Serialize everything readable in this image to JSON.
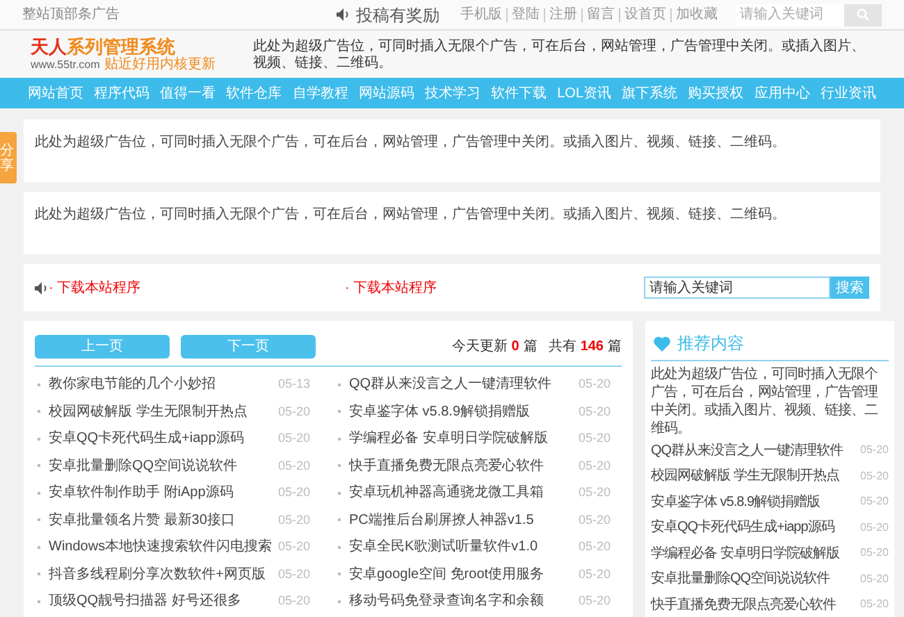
{
  "top_bar": {
    "left_text": "整站顶部条广告",
    "promo": "投稿有奖励",
    "links": [
      "手机版",
      "登陆",
      "注册",
      "留言",
      "设首页",
      "加收藏"
    ],
    "search": {
      "placeholder": "请输入关键词"
    }
  },
  "header": {
    "logo": {
      "part_1": "天人",
      "part_2": "系列管理系统",
      "url": "www.55tr.com",
      "slogan": "贴近好用内核更新"
    },
    "ad": "此处为超级广告位，可同时插入无限个广告，可在后台，网站管理，广告管理中关闭。或插入图片、视频、链接、二维码。"
  },
  "nav": [
    "网站首页",
    "程序代码",
    "值得一看",
    "软件仓库",
    "自学教程",
    "网站源码",
    "技术学习",
    "软件下载",
    "LOL资讯",
    "旗下系统",
    "购买授权",
    "应用中心",
    "行业资讯"
  ],
  "share_tab": "分享",
  "ads": [
    "此处为超级广告位，可同时插入无限个广告，可在后台，网站管理，广告管理中关闭。或插入图片、视频、链接、二维码。",
    "此处为超级广告位，可同时插入无限个广告，可在后台，网站管理，广告管理中关闭。或插入图片、视频、链接、二维码。"
  ],
  "notice_bar": {
    "links": [
      "· 下载本站程序",
      "· 下载本站程序"
    ],
    "search": {
      "value": "请输入关键词",
      "button": "搜索"
    }
  },
  "list_panel": {
    "prev": "上一页",
    "next": "下一页",
    "today_label": "今天更新",
    "today_count": "0",
    "unit_1": "篇",
    "total_label": "共有",
    "total_count": "146",
    "unit_2": "篇",
    "items": [
      {
        "title": "教你家电节能的几个小妙招",
        "date": "05-13"
      },
      {
        "title": "QQ群从来没言之人一键清理软件",
        "date": "05-20"
      },
      {
        "title": "校园网破解版 学生无限制开热点",
        "date": "05-20"
      },
      {
        "title": "安卓鉴字体 v5.8.9解锁捐赠版",
        "date": "05-20"
      },
      {
        "title": "安卓QQ卡死代码生成+iapp源码",
        "date": "05-20"
      },
      {
        "title": "学编程必备 安卓明日学院破解版",
        "date": "05-20"
      },
      {
        "title": "安卓批量删除QQ空间说说软件",
        "date": "05-20"
      },
      {
        "title": "快手直播免费无限点亮爱心软件",
        "date": "05-20"
      },
      {
        "title": "安卓软件制作助手 附iApp源码",
        "date": "05-20"
      },
      {
        "title": "安卓玩机神器高通骁龙微工具箱",
        "date": "05-20"
      },
      {
        "title": "安卓批量领名片赞 最新30接口",
        "date": "05-20"
      },
      {
        "title": "PC端推后台刷屏撩人神器v1.5",
        "date": "05-20"
      },
      {
        "title": "Windows本地快速搜索软件闪电搜索",
        "date": "05-20"
      },
      {
        "title": "安卓全民K歌测试听量软件v1.0",
        "date": "05-20"
      },
      {
        "title": "抖音多线程刷分享次数软件+网页版",
        "date": "05-20"
      },
      {
        "title": "安卓google空间 免root使用服务",
        "date": "05-20"
      },
      {
        "title": "顶级QQ靓号扫描器 好号还很多",
        "date": "05-20"
      },
      {
        "title": "移动号码免登录查询名字和余额",
        "date": "05-20"
      }
    ]
  },
  "sidebar": {
    "title": "推荐内容",
    "ad": "此处为超级广告位，可同时插入无限个广告，可在后台，网站管理，广告管理中关闭。或插入图片、视频、链接、二维码。",
    "items": [
      {
        "title": "QQ群从来没言之人一键清理软件",
        "date": "05-20"
      },
      {
        "title": "校园网破解版 学生无限制开热点",
        "date": "05-20"
      },
      {
        "title": "安卓鉴字体 v5.8.9解锁捐赠版",
        "date": "05-20"
      },
      {
        "title": "安卓QQ卡死代码生成+iapp源码",
        "date": "05-20"
      },
      {
        "title": "学编程必备 安卓明日学院破解版",
        "date": "05-20"
      },
      {
        "title": "安卓批量删除QQ空间说说软件",
        "date": "05-20"
      },
      {
        "title": "快手直播免费无限点亮爱心软件",
        "date": "05-20"
      }
    ]
  }
}
